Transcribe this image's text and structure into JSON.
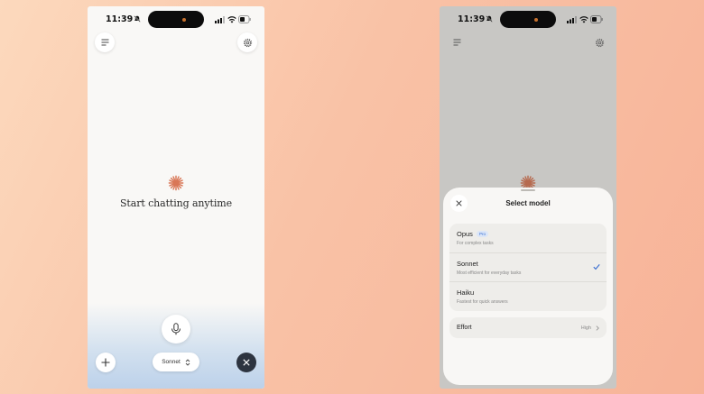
{
  "left_phone": {
    "status": {
      "time": "11:39"
    },
    "tagline": "Start chatting anytime",
    "model_pill": {
      "label": "Sonnet"
    }
  },
  "right_phone": {
    "status": {
      "time": "11:39"
    },
    "sheet": {
      "title": "Select model",
      "models": [
        {
          "name": "Opus",
          "badge": "Pro",
          "desc": "For complex tasks",
          "selected": false
        },
        {
          "name": "Sonnet",
          "badge": "",
          "desc": "Most efficient for everyday tasks",
          "selected": true
        },
        {
          "name": "Haiku",
          "badge": "",
          "desc": "Fastest for quick answers",
          "selected": false
        }
      ],
      "effort": {
        "label": "Effort",
        "value": "High"
      }
    }
  },
  "colors": {
    "accent_spark": "#d97757",
    "check": "#3a6fd1",
    "dark_button": "#2d3440"
  },
  "icons": [
    "menu-icon",
    "gear-icon",
    "spark-icon",
    "mic-icon",
    "plus-icon",
    "chevron-updown-icon",
    "close-icon",
    "check-icon",
    "chevron-right-icon"
  ]
}
